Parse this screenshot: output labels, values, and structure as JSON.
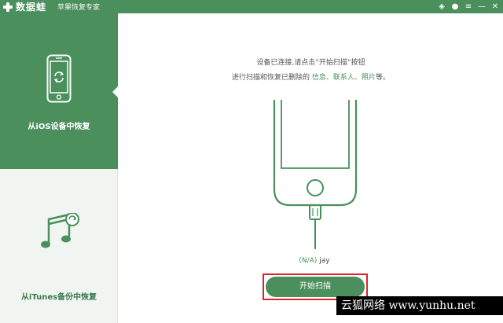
{
  "titlebar": {
    "app_name": "数据蛙",
    "subtitle": "苹果恢复专家",
    "icons": [
      "diamond-icon",
      "chat-icon",
      "menu-icon",
      "minimize-icon",
      "close-icon"
    ],
    "icon_glyphs": {
      "diamond": "◈",
      "chat": "●",
      "menu": "≡",
      "minimize": "—",
      "close": "✕"
    }
  },
  "sidebar": {
    "items": [
      {
        "label": "从iOS设备中恢复",
        "icon": "phone-refresh-icon",
        "active": true
      },
      {
        "label": "从iTunes备份中恢复",
        "icon": "itunes-music-icon",
        "active": false
      }
    ]
  },
  "main": {
    "instruction_line1": "设备已连接,请点击“开始扫描”按钮",
    "instruction_line2_prefix": "进行扫描和恢复已删除的 ",
    "instruction_line2_highlight": "信息、联系人、照片",
    "instruction_line2_suffix": "等。",
    "device_status": "(N/A)",
    "device_name": " jay",
    "scan_button_label": "开始扫描"
  },
  "watermark": {
    "text": "云狐网络 www.yunhu.net"
  },
  "colors": {
    "brand_green": "#4a8f5c",
    "highlight_red": "#d9262c",
    "sidebar_bg": "#f1f5f1"
  }
}
